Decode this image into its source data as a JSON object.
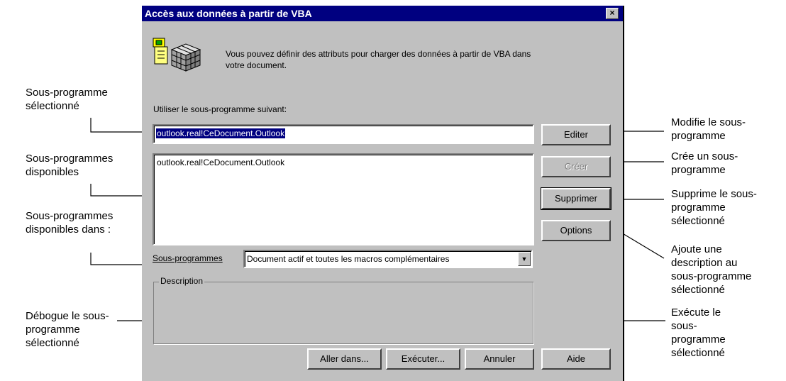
{
  "dialog": {
    "title": "Accès aux données à partir de VBA",
    "intro": "Vous pouvez définir des attributs pour charger des données à partir de VBA dans\nvotre document.",
    "use_label": "Utiliser le sous-programme suivant:",
    "selected_value": "outlook.real!CeDocument.Outlook",
    "list_items": [
      "outlook.real!CeDocument.Outlook"
    ],
    "scope_label": "Sous-programmes",
    "scope_value": "Document actif et toutes les macros complémentaires",
    "description_label": "Description",
    "buttons": {
      "edit": "Editer",
      "create": "Créer",
      "delete": "Supprimer",
      "options": "Options",
      "step_into": "Aller dans...",
      "run": "Exécuter...",
      "cancel": "Annuler",
      "help": "Aide"
    },
    "close_glyph": "×"
  },
  "annotations": {
    "selected": "Sous-programme\nsélectionné",
    "available": "Sous-programmes\ndisponibles",
    "available_in": "Sous-programmes\ndisponibles dans :",
    "debug": "Débogue le sous-\nprogramme\nsélectionné",
    "modify": "Modifie le sous-\nprogramme",
    "create": "Crée un sous-\nprogramme",
    "delete": "Supprime le sous-\nprogramme\nsélectionné",
    "options": "Ajoute une\ndescription au\nsous-programme\nsélectionné",
    "run": "Exécute le\nsous-\nprogramme\nsélectionné"
  }
}
